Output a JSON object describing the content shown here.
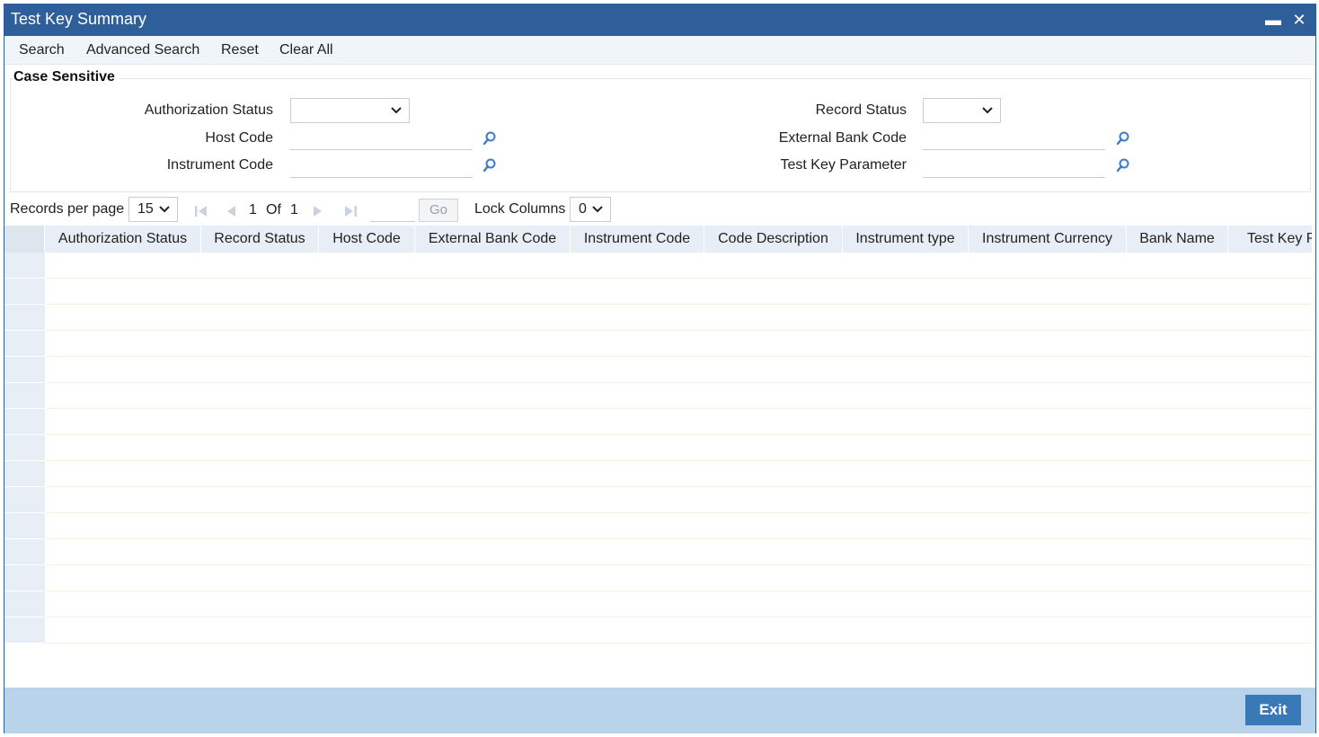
{
  "window": {
    "title": "Test Key Summary",
    "minimize_glyph": "▬",
    "close_glyph": "✕"
  },
  "toolbar": {
    "items": [
      "Search",
      "Advanced Search",
      "Reset",
      "Clear All"
    ]
  },
  "criteria": {
    "legend": "Case Sensitive",
    "authorization_status_label": "Authorization Status",
    "authorization_status_value": "",
    "host_code_label": "Host Code",
    "host_code_value": "",
    "instrument_code_label": "Instrument Code",
    "instrument_code_value": "",
    "record_status_label": "Record Status",
    "record_status_value": "",
    "external_bank_code_label": "External Bank Code",
    "external_bank_code_value": "",
    "test_key_parameter_label": "Test Key Parameter",
    "test_key_parameter_value": ""
  },
  "pager": {
    "records_per_page_label": "Records per page",
    "records_per_page_value": "15",
    "current_page": "1",
    "of_label": "Of",
    "total_pages": "1",
    "go_label": "Go",
    "lock_columns_label": "Lock Columns",
    "lock_columns_value": "0"
  },
  "grid": {
    "columns": [
      "Authorization Status",
      "Record Status",
      "Host Code",
      "External Bank Code",
      "Instrument Code",
      "Code Description",
      "Instrument type",
      "Instrument Currency",
      "Bank Name",
      "Test Key P"
    ],
    "row_count": 15
  },
  "footer": {
    "exit_label": "Exit"
  },
  "colors": {
    "title_bar": "#2f5f9b",
    "footer": "#b9d4ea",
    "exit_button": "#3a79b8",
    "header_bg": "#e8eef5",
    "icon_blue": "#3d7bc8"
  },
  "icons": {
    "lookup": "magnifier-icon",
    "dropdown": "chevron-down-icon",
    "first": "first-page-icon",
    "prev": "previous-page-icon",
    "next": "next-page-icon",
    "last": "last-page-icon"
  }
}
